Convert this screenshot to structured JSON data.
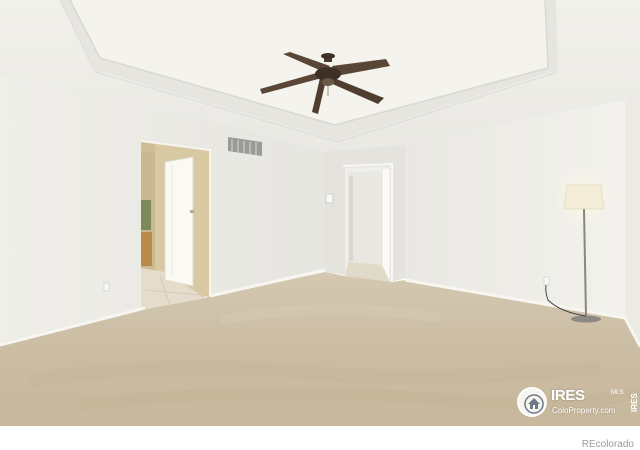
{
  "photo": {
    "subject": "empty-bedroom"
  },
  "watermark": {
    "brand": "IRES",
    "brand_suffix": "MLS",
    "site": "ColoProperty.com",
    "vertical_mark": "IRES",
    "logo_icon": "house-icon"
  },
  "credit": {
    "text": "REcolorado"
  },
  "colors": {
    "wall": "#ecebe6",
    "ceiling": "#f2f1ec",
    "carpet": "#cdbfa6",
    "fan": "#4a3a2e",
    "door_frame": "#d8c9a6"
  }
}
